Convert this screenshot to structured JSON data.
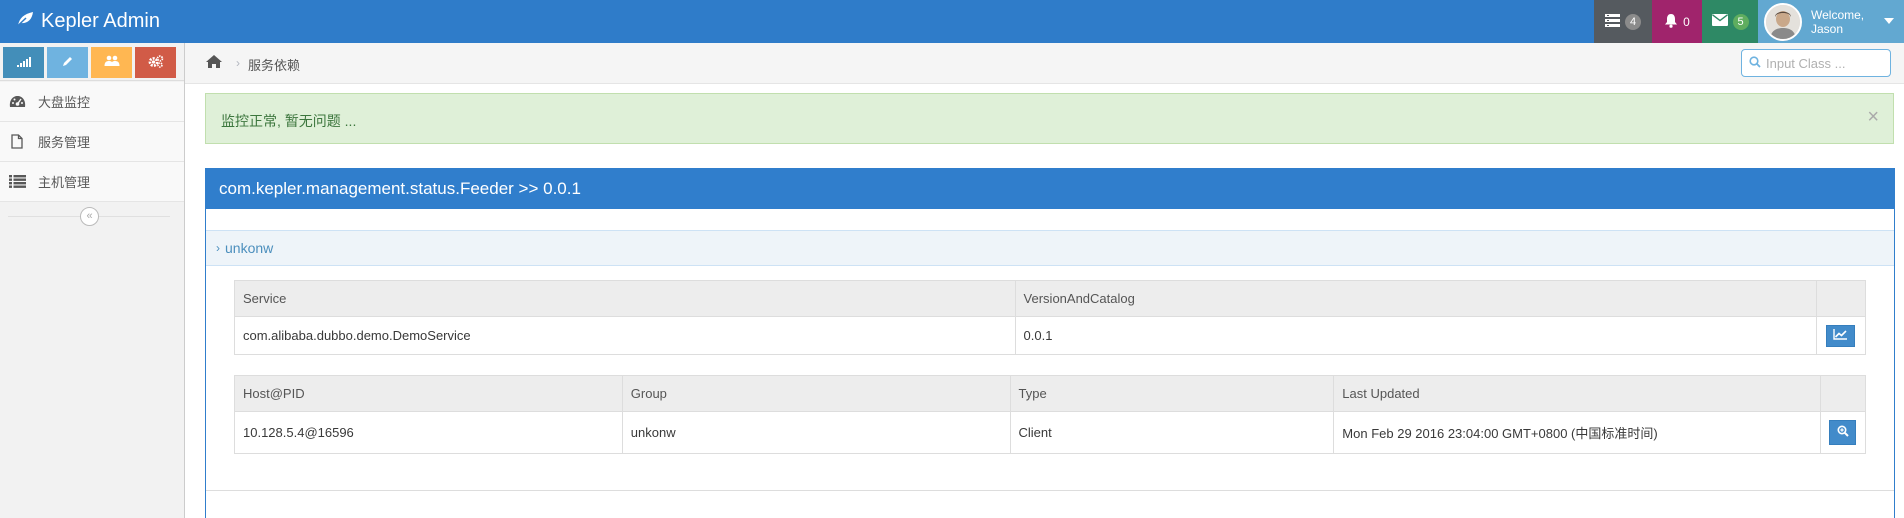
{
  "app": {
    "title": "Kepler Admin"
  },
  "navbar": {
    "tasks_count": "4",
    "notifications_count": "0",
    "messages_count": "5",
    "welcome_line1": "Welcome,",
    "welcome_line2": "Jason"
  },
  "sidebar": {
    "items": [
      {
        "label": "大盘监控",
        "icon": "dashboard-icon"
      },
      {
        "label": "服务管理",
        "icon": "file-icon"
      },
      {
        "label": "主机管理",
        "icon": "list-icon"
      }
    ],
    "shortcuts": [
      "signal-icon",
      "pencil-icon",
      "users-icon",
      "cogs-icon"
    ]
  },
  "breadcrumb": {
    "current": "服务依赖"
  },
  "search": {
    "placeholder": "Input Class ..."
  },
  "alert": {
    "text": "监控正常, 暂无问题 ...",
    "close": "×"
  },
  "panel": {
    "title": "com.kepler.management.status.Feeder >> 0.0.1",
    "section_label": "unkonw"
  },
  "service_table": {
    "headers": [
      "Service",
      "VersionAndCatalog"
    ],
    "rows": [
      {
        "service": "com.alibaba.dubbo.demo.DemoService",
        "version": "0.0.1"
      }
    ]
  },
  "host_table": {
    "headers": [
      "Host@PID",
      "Group",
      "Type",
      "Last Updated"
    ],
    "rows": [
      {
        "host": "10.128.5.4@16596",
        "group": "unkonw",
        "type": "Client",
        "updated": "Mon Feb 29 2016 23:04:00 GMT+0800 (中国标准时间)"
      }
    ]
  },
  "colors": {
    "navbar": "#2f7cc9",
    "panel_header": "#307ecc",
    "alert_bg": "#dff0d8",
    "alert_text": "#3c763d"
  }
}
